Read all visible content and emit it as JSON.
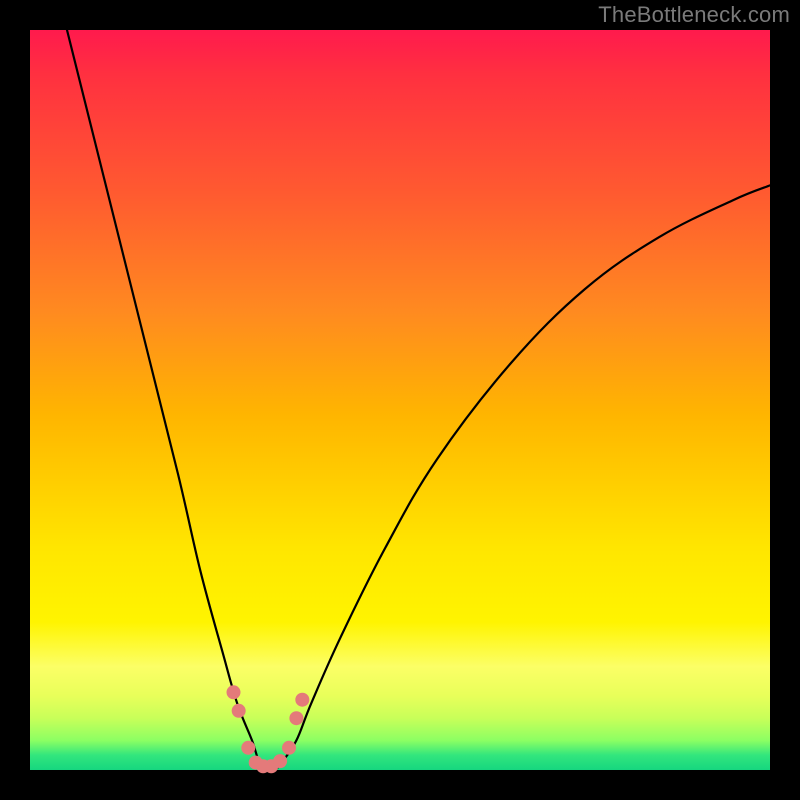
{
  "watermark": "TheBottleneck.com",
  "chart_data": {
    "type": "line",
    "title": "",
    "xlabel": "",
    "ylabel": "",
    "xlim": [
      0,
      100
    ],
    "ylim": [
      0,
      100
    ],
    "grid": false,
    "legend": false,
    "annotations": [],
    "gradient_stops": [
      {
        "pct": 0,
        "color": "#ff1a4d"
      },
      {
        "pct": 22,
        "color": "#ff5a30"
      },
      {
        "pct": 52,
        "color": "#ffb500"
      },
      {
        "pct": 80,
        "color": "#fff400"
      },
      {
        "pct": 96,
        "color": "#8cff63"
      },
      {
        "pct": 100,
        "color": "#16d67f"
      }
    ],
    "series": [
      {
        "name": "bottleneck-curve",
        "x": [
          5,
          10,
          15,
          20,
          23,
          26,
          28,
          30,
          31,
          32,
          33,
          34,
          36,
          38,
          42,
          48,
          55,
          65,
          75,
          85,
          95,
          100
        ],
        "values": [
          100,
          80,
          60,
          40,
          27,
          16,
          9,
          4,
          1,
          0,
          0,
          1,
          4,
          9,
          18,
          30,
          42,
          55,
          65,
          72,
          77,
          79
        ]
      }
    ],
    "markers": {
      "name": "valley-dots",
      "color": "#e47a7a",
      "radius_px": 7,
      "x": [
        27.5,
        28.2,
        29.5,
        30.5,
        31.5,
        32.6,
        33.8,
        35.0,
        36.0,
        36.8
      ],
      "values": [
        10.5,
        8.0,
        3.0,
        1.0,
        0.5,
        0.5,
        1.2,
        3.0,
        7.0,
        9.5
      ]
    },
    "minimum_at_x": 32
  }
}
